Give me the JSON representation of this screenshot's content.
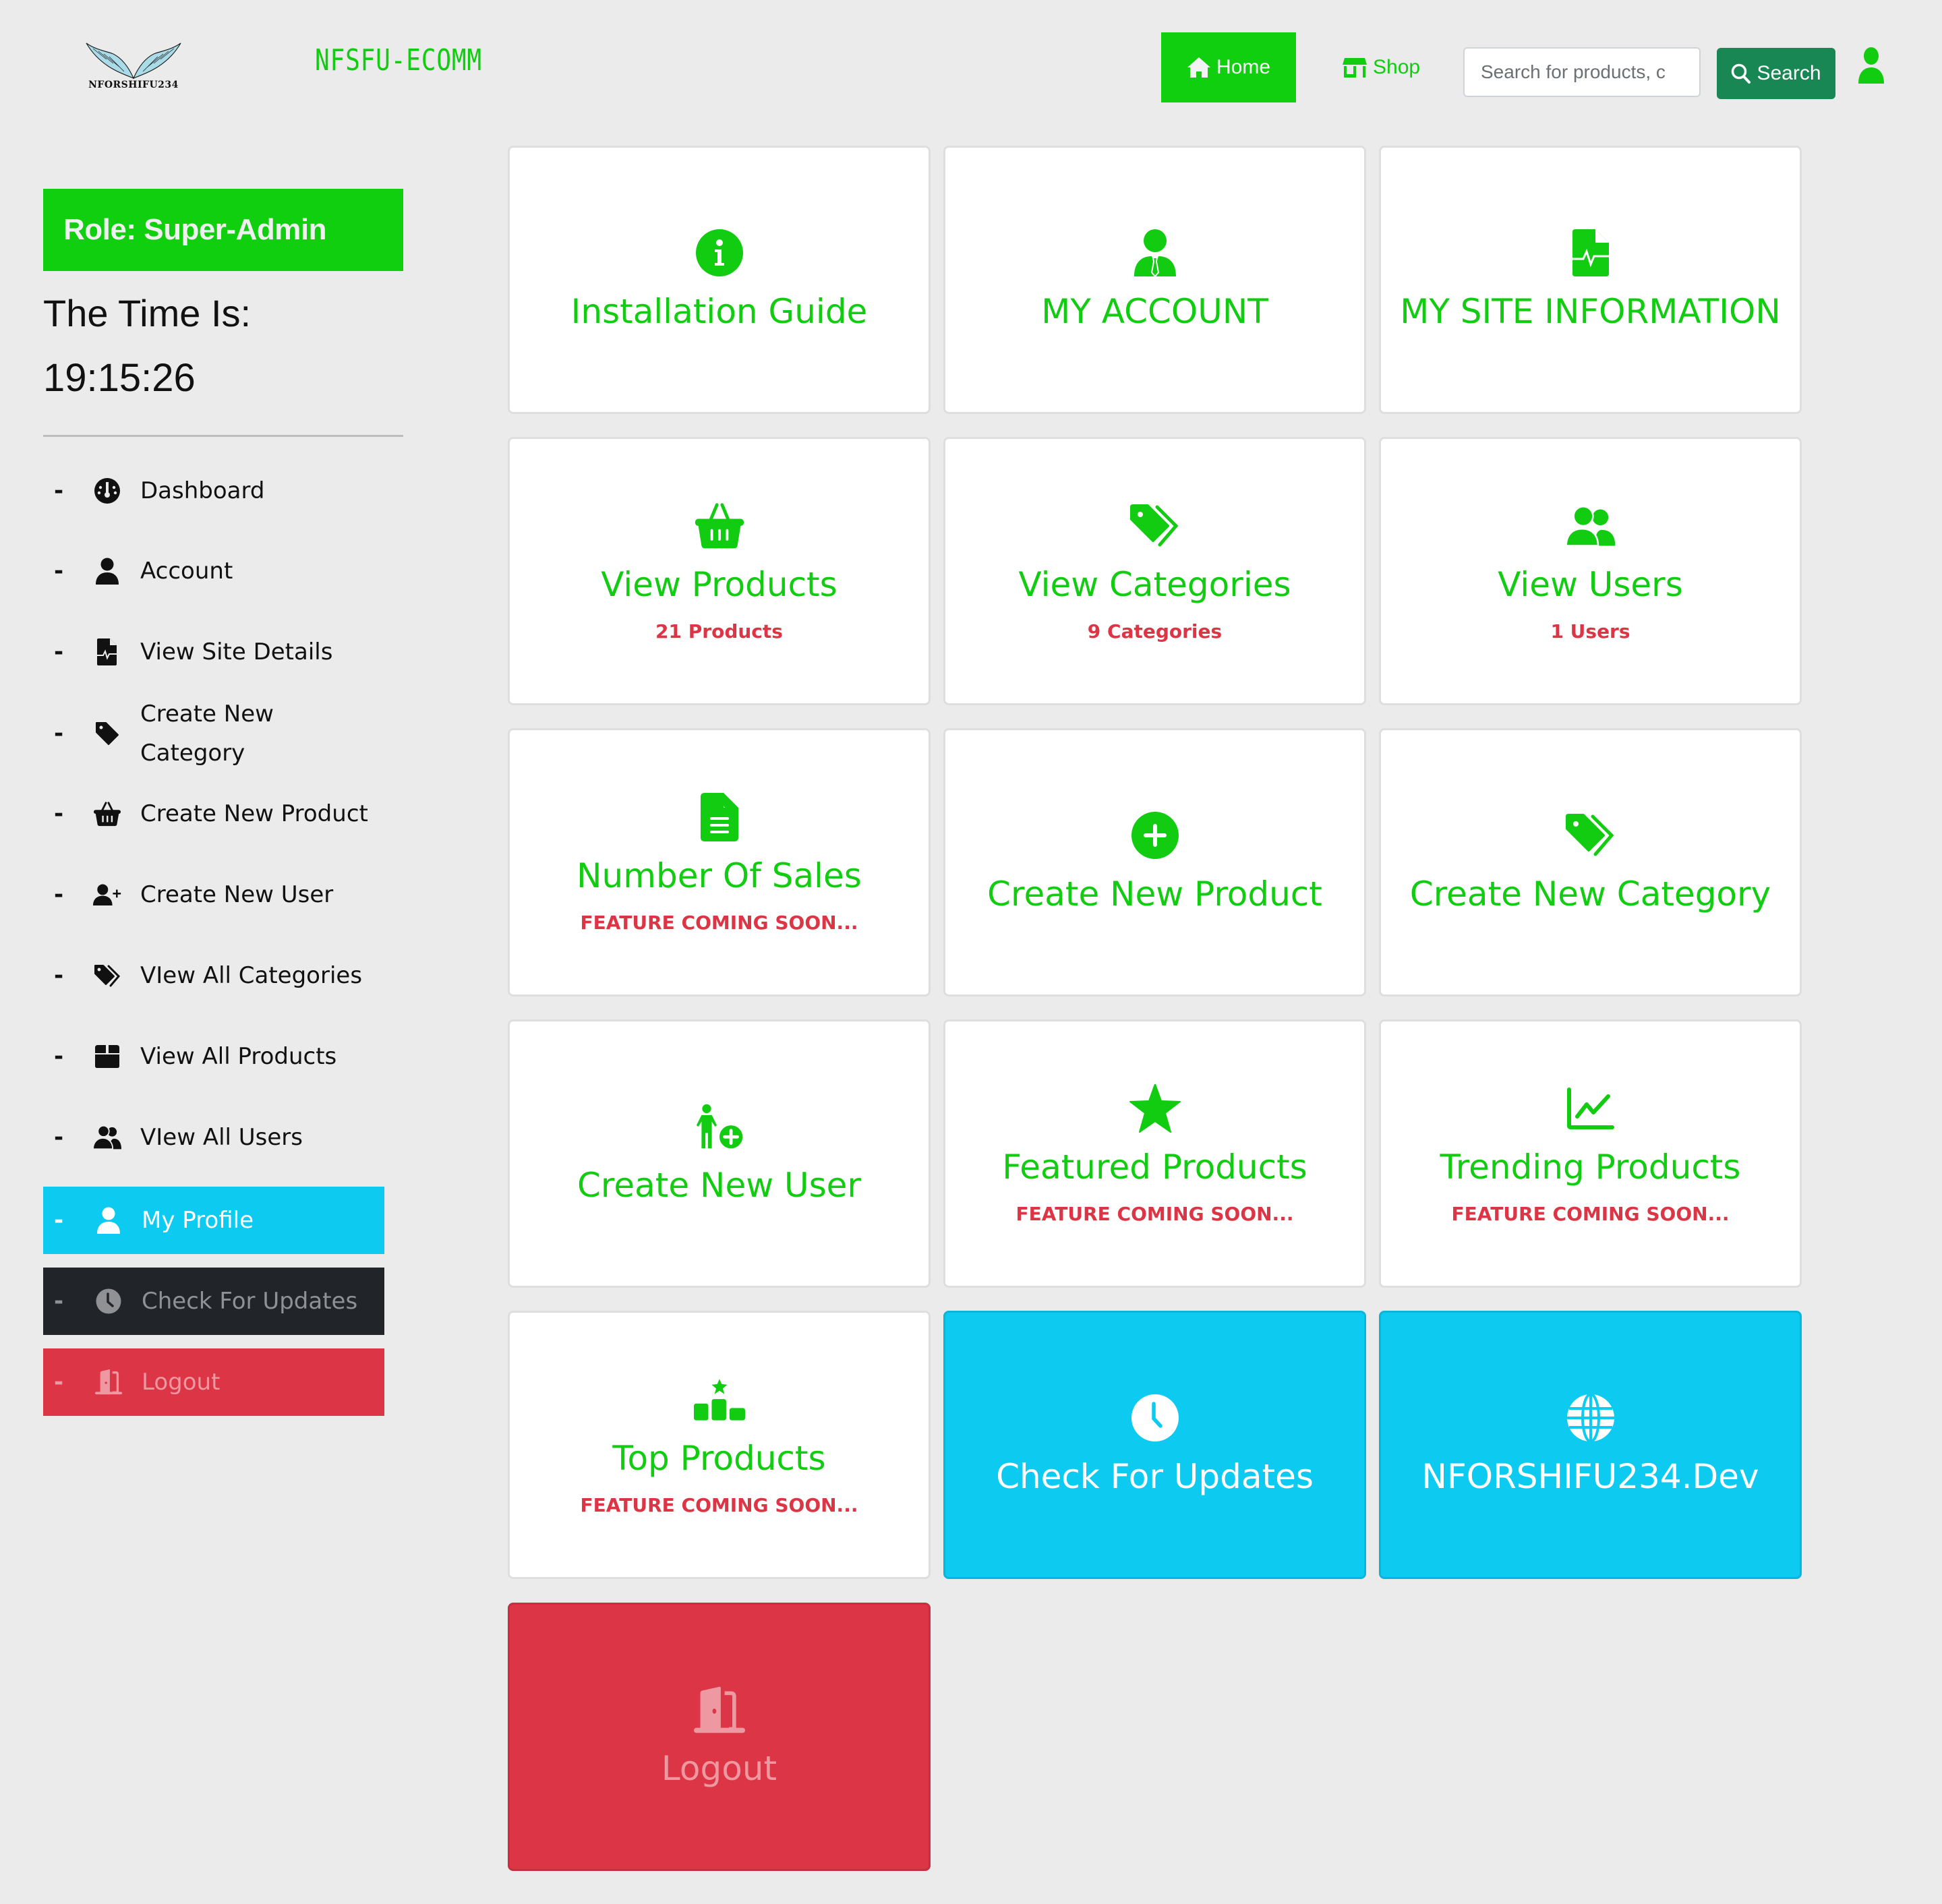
{
  "header": {
    "logo_text": "NFORSHIFU234",
    "brand": "NFSFU-ECOMM",
    "nav": {
      "home": {
        "label": "Home",
        "icon": "home-icon",
        "active": true
      },
      "shop": {
        "label": "Shop",
        "icon": "shop-icon"
      }
    },
    "search": {
      "placeholder": "Search for products, c",
      "value": "",
      "button_label": "Search"
    },
    "user_icon": "user-icon"
  },
  "sidebar": {
    "role": "Role: Super-Admin",
    "time_label": "The Time Is:",
    "time_value": "19:15:26",
    "items": [
      {
        "dash": "-",
        "label": "Dashboard",
        "icon": "gauge-icon"
      },
      {
        "dash": "-",
        "label": "Account",
        "icon": "user-icon"
      },
      {
        "dash": "-",
        "label": "View Site Details",
        "icon": "file-waveform-icon"
      },
      {
        "dash": "-",
        "label": "Create New Category",
        "icon": "tag-icon"
      },
      {
        "dash": "-",
        "label": "Create New Product",
        "icon": "basket-icon"
      },
      {
        "dash": "-",
        "label": "Create New User",
        "icon": "user-plus-icon"
      },
      {
        "dash": "-",
        "label": "VIew All Categories",
        "icon": "tags-icon"
      },
      {
        "dash": "-",
        "label": "View All Products",
        "icon": "box-icon"
      },
      {
        "dash": "-",
        "label": "VIew All Users",
        "icon": "users-icon"
      }
    ],
    "buttons": [
      {
        "dash": "-",
        "label": "My Profile",
        "icon": "user-icon",
        "color": "#0dcaf0"
      },
      {
        "dash": "-",
        "label": "Check For Updates",
        "icon": "clock-icon",
        "color": "#212529"
      },
      {
        "dash": "-",
        "label": "Logout",
        "icon": "door-open-icon",
        "color": "#dc3545"
      }
    ]
  },
  "cards": [
    {
      "title": "Installation Guide",
      "subtitle": null,
      "icon": "info-circle-icon",
      "variant": "light"
    },
    {
      "title": "MY ACCOUNT",
      "subtitle": null,
      "icon": "user-tie-icon",
      "variant": "light"
    },
    {
      "title": "MY SITE INFORMATION",
      "subtitle": null,
      "icon": "file-waveform-icon",
      "variant": "light"
    },
    {
      "title": "View Products",
      "subtitle": "21 Products",
      "icon": "basket-icon",
      "variant": "light"
    },
    {
      "title": "View Categories",
      "subtitle": "9 Categories",
      "icon": "tags-icon",
      "variant": "light"
    },
    {
      "title": "View Users",
      "subtitle": "1 Users",
      "icon": "users-icon",
      "variant": "light"
    },
    {
      "title": "Number Of Sales",
      "subtitle": "FEATURE COMING SOON...",
      "icon": "file-lines-icon",
      "variant": "light"
    },
    {
      "title": "Create New Product",
      "subtitle": null,
      "icon": "plus-circle-icon",
      "variant": "light"
    },
    {
      "title": "Create New Category",
      "subtitle": null,
      "icon": "tags-icon",
      "variant": "light"
    },
    {
      "title": "Create New User",
      "subtitle": null,
      "icon": "child-plus-icon",
      "variant": "light"
    },
    {
      "title": "Featured Products",
      "subtitle": "FEATURE COMING SOON...",
      "icon": "star-icon",
      "variant": "light"
    },
    {
      "title": "Trending Products",
      "subtitle": "FEATURE COMING SOON...",
      "icon": "chart-line-icon",
      "variant": "light"
    },
    {
      "title": "Top Products",
      "subtitle": "FEATURE COMING SOON...",
      "icon": "ranking-star-icon",
      "variant": "light"
    },
    {
      "title": "Check For Updates",
      "subtitle": null,
      "icon": "clock-icon",
      "variant": "info"
    },
    {
      "title": "NFORSHIFU234.Dev",
      "subtitle": null,
      "icon": "globe-icon",
      "variant": "info"
    },
    {
      "title": "Logout",
      "subtitle": null,
      "icon": "door-open-icon",
      "variant": "danger"
    }
  ],
  "colors": {
    "accent_green": "#11cc11",
    "nav_green": "#0fcf0f",
    "search_button": "#198754",
    "info": "#0dcaf0",
    "danger": "#dc3545",
    "dark": "#212529",
    "page_bg": "#ebebeb"
  }
}
